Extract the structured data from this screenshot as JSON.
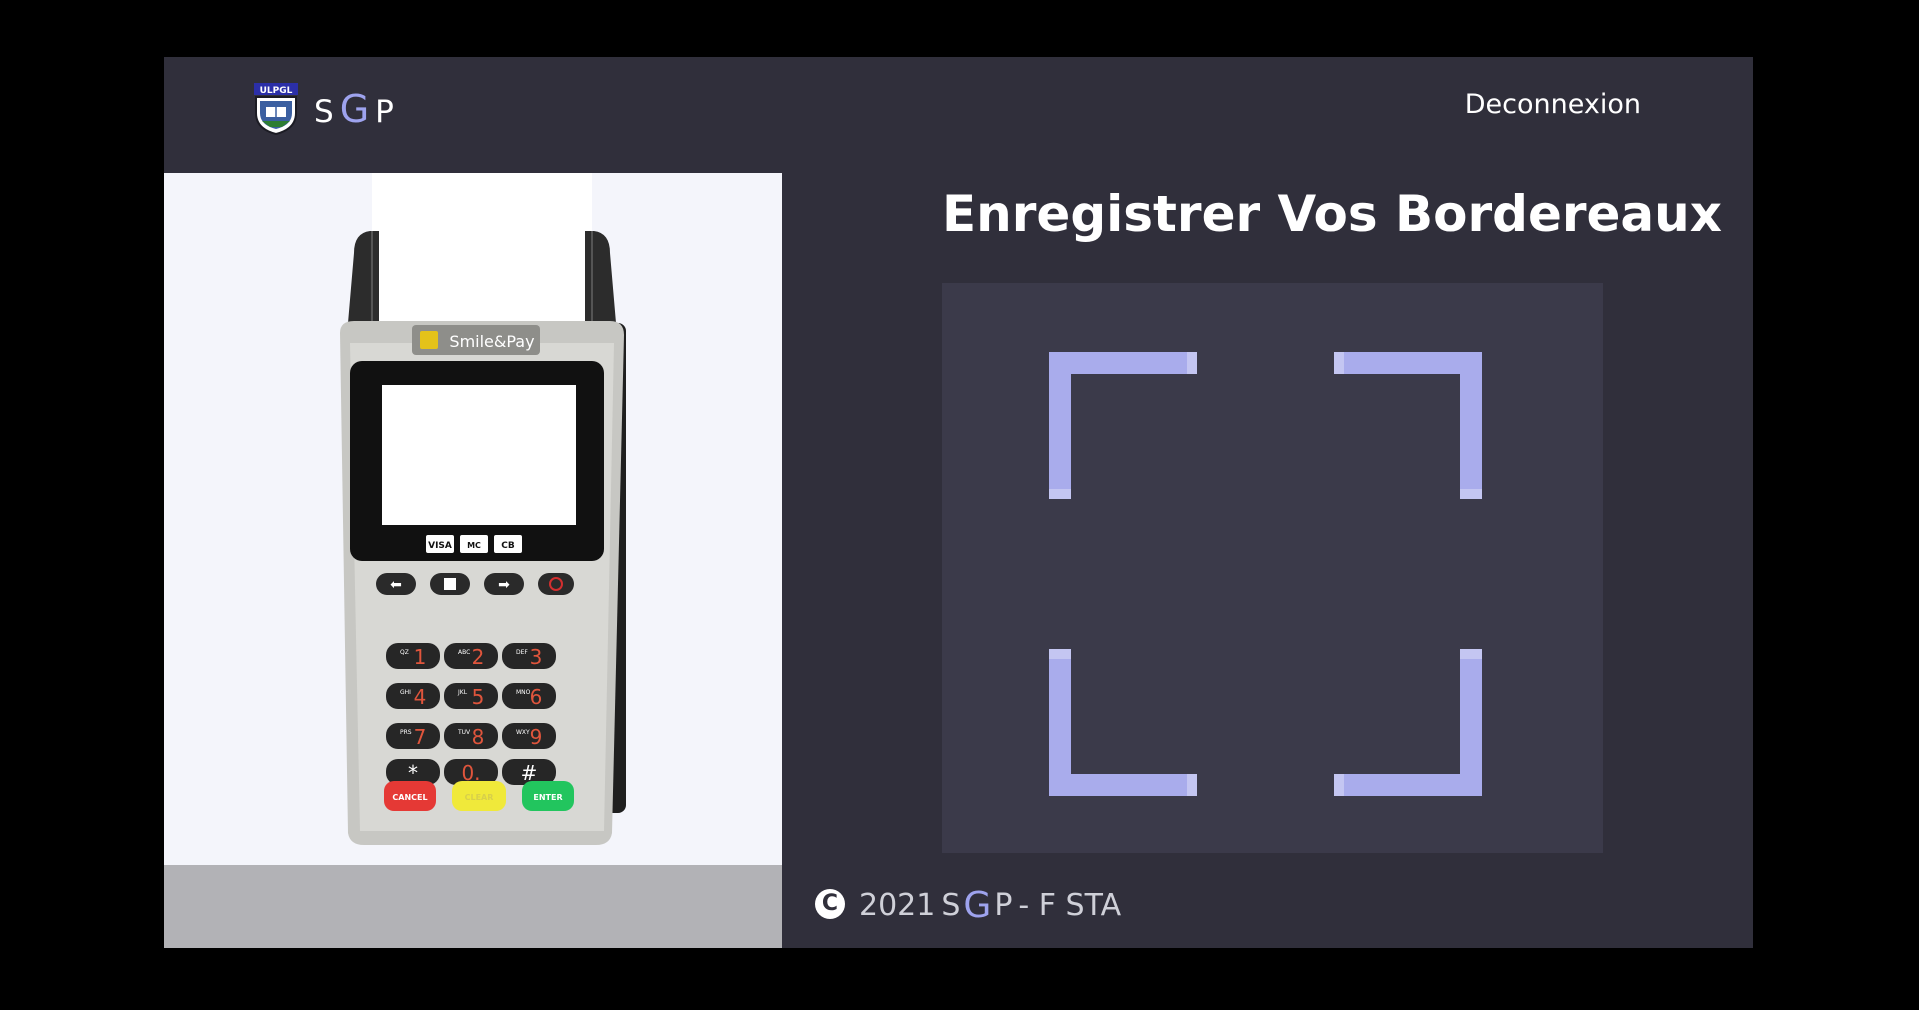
{
  "header": {
    "logo_text": "ULPGL",
    "brand": {
      "s": "S",
      "g": "G",
      "p": "P"
    },
    "logout_label": "Deconnexion"
  },
  "terminal": {
    "brand_label": "Smile&Pay",
    "card_logos": [
      "VISA",
      "MC",
      "CB"
    ],
    "keys": [
      {
        "main": "1",
        "sub": "QZ"
      },
      {
        "main": "2",
        "sub": "ABC"
      },
      {
        "main": "3",
        "sub": "DEF"
      },
      {
        "main": "4",
        "sub": "GHI"
      },
      {
        "main": "5",
        "sub": "JKL"
      },
      {
        "main": "6",
        "sub": "MNO"
      },
      {
        "main": "7",
        "sub": "PRS"
      },
      {
        "main": "8",
        "sub": "TUV"
      },
      {
        "main": "9",
        "sub": "WXY"
      },
      {
        "main": "*",
        "sub": ""
      },
      {
        "main": "0.",
        "sub": ""
      },
      {
        "main": "#",
        "sub": ""
      }
    ],
    "cancel_label": "CANCEL",
    "clear_label": "CLEAR",
    "enter_label": "ENTER"
  },
  "main": {
    "title": "Enregistrer Vos Bordereaux",
    "scanner_icon": "scan-frame-icon"
  },
  "footer": {
    "copyright_icon": "C",
    "year": "2021",
    "brand": {
      "s": "S",
      "g": "G",
      "p": "P"
    },
    "suffix": "- F STA"
  },
  "colors": {
    "page_bg": "#000000",
    "app_bg": "#302f3b",
    "scanner_bg": "#3b3a4a",
    "accent": "#9ea3ee",
    "panel_bg": "#f4f5fb"
  }
}
